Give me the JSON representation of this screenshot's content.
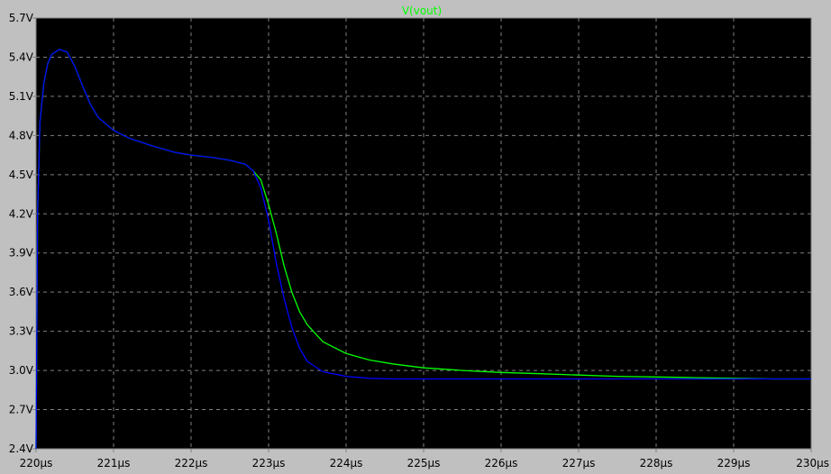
{
  "chart_data": {
    "type": "line",
    "title": "V(vout)",
    "xlabel": "",
    "ylabel": "",
    "xlim": [
      220,
      230
    ],
    "ylim": [
      2.4,
      5.7
    ],
    "grid": true,
    "x_ticks": [
      "220µs",
      "221µs",
      "222µs",
      "223µs",
      "224µs",
      "225µs",
      "226µs",
      "227µs",
      "228µs",
      "229µs",
      "230µs"
    ],
    "x_tick_values": [
      220,
      221,
      222,
      223,
      224,
      225,
      226,
      227,
      228,
      229,
      230
    ],
    "y_ticks": [
      "2.4V",
      "2.7V",
      "3.0V",
      "3.3V",
      "3.6V",
      "3.9V",
      "4.2V",
      "4.5V",
      "4.8V",
      "5.1V",
      "5.4V",
      "5.7V"
    ],
    "y_tick_values": [
      2.4,
      2.7,
      3.0,
      3.3,
      3.6,
      3.9,
      4.2,
      4.5,
      4.8,
      5.1,
      5.4,
      5.7
    ],
    "colors": {
      "background": "#000000",
      "frame_bg": "#c0c0c0",
      "grid": "#808080",
      "title": "#00ff00"
    },
    "series": [
      {
        "color": "#00ff00",
        "x": [
          220.0,
          220.02,
          220.05,
          220.1,
          220.15,
          220.2,
          220.3,
          220.4,
          220.5,
          220.6,
          220.7,
          220.8,
          221.0,
          221.2,
          221.5,
          221.8,
          222.0,
          222.3,
          222.5,
          222.7,
          222.8,
          222.9,
          223.0,
          223.1,
          223.2,
          223.3,
          223.4,
          223.5,
          223.7,
          224.0,
          224.3,
          224.6,
          225.0,
          225.5,
          226.0,
          226.5,
          227.0,
          227.5,
          228.0,
          228.5,
          229.0,
          229.5,
          230.0
        ],
        "y": [
          2.4,
          4.2,
          4.9,
          5.2,
          5.35,
          5.42,
          5.46,
          5.44,
          5.33,
          5.18,
          5.04,
          4.94,
          4.84,
          4.78,
          4.72,
          4.67,
          4.65,
          4.63,
          4.61,
          4.58,
          4.53,
          4.46,
          4.27,
          4.05,
          3.8,
          3.6,
          3.45,
          3.35,
          3.22,
          3.13,
          3.08,
          3.05,
          3.02,
          3.0,
          2.985,
          2.975,
          2.965,
          2.955,
          2.95,
          2.945,
          2.94,
          2.935,
          2.935
        ]
      },
      {
        "color": "#0000ff",
        "x": [
          220.0,
          220.02,
          220.05,
          220.1,
          220.15,
          220.2,
          220.3,
          220.4,
          220.5,
          220.6,
          220.7,
          220.8,
          221.0,
          221.2,
          221.5,
          221.8,
          222.0,
          222.3,
          222.5,
          222.7,
          222.8,
          222.9,
          223.0,
          223.1,
          223.2,
          223.3,
          223.4,
          223.5,
          223.7,
          224.0,
          224.3,
          224.6,
          225.0,
          225.5,
          226.0,
          226.5,
          227.0,
          227.5,
          228.0,
          228.5,
          229.0,
          229.5,
          230.0
        ],
        "y": [
          2.4,
          4.2,
          4.9,
          5.2,
          5.35,
          5.42,
          5.46,
          5.44,
          5.33,
          5.18,
          5.04,
          4.94,
          4.84,
          4.78,
          4.72,
          4.67,
          4.65,
          4.63,
          4.61,
          4.58,
          4.53,
          4.4,
          4.15,
          3.82,
          3.55,
          3.33,
          3.17,
          3.07,
          2.99,
          2.955,
          2.94,
          2.935,
          2.935,
          2.935,
          2.935,
          2.935,
          2.935,
          2.935,
          2.935,
          2.935,
          2.935,
          2.935,
          2.935
        ]
      }
    ]
  }
}
